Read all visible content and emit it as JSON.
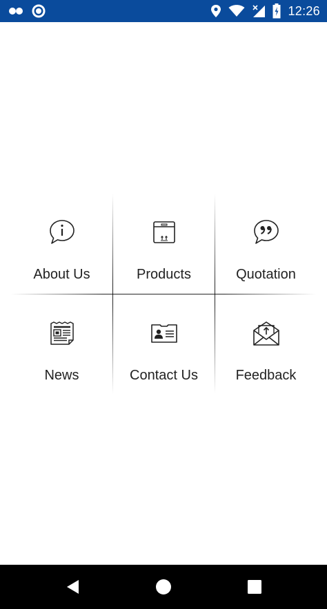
{
  "status_bar": {
    "time": "12:26",
    "background": "#0a4b9c",
    "icons": [
      "notification-dots-icon",
      "circle-app-icon",
      "location-icon",
      "wifi-icon",
      "signal-icon",
      "battery-charging-icon"
    ]
  },
  "menu": {
    "items": [
      {
        "label": "About Us",
        "icon": "info-chat-icon"
      },
      {
        "label": "Products",
        "icon": "box-icon"
      },
      {
        "label": "Quotation",
        "icon": "quote-chat-icon"
      },
      {
        "label": "News",
        "icon": "newspaper-icon"
      },
      {
        "label": "Contact Us",
        "icon": "contact-card-icon"
      },
      {
        "label": "Feedback",
        "icon": "envelope-upload-icon"
      }
    ]
  },
  "nav_bar": {
    "buttons": [
      "back-icon",
      "home-icon",
      "recents-icon"
    ]
  }
}
